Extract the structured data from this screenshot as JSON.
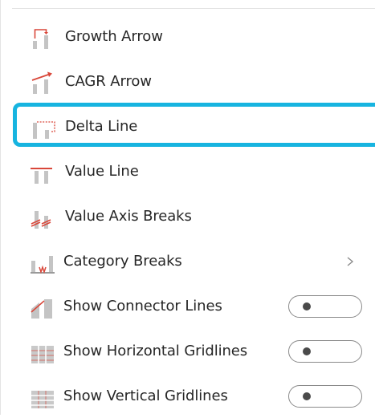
{
  "menu": {
    "items": [
      {
        "label": "Growth Arrow",
        "icon": "growth-arrow-icon"
      },
      {
        "label": "CAGR Arrow",
        "icon": "cagr-arrow-icon"
      },
      {
        "label": "Delta Line",
        "icon": "delta-line-icon",
        "focused": true
      },
      {
        "label": "Value Line",
        "icon": "value-line-icon"
      },
      {
        "label": "Value Axis Breaks",
        "icon": "value-axis-breaks-icon"
      },
      {
        "label": "Category Breaks",
        "icon": "category-breaks-icon",
        "submenu": true
      },
      {
        "label": "Show Connector Lines",
        "icon": "connector-lines-icon",
        "toggle": false
      },
      {
        "label": "Show Horizontal Gridlines",
        "icon": "horizontal-gridlines-icon",
        "toggle": false
      },
      {
        "label": "Show Vertical Gridlines",
        "icon": "vertical-gridlines-icon",
        "toggle": false
      }
    ]
  },
  "colors": {
    "focus_ring": "#17b4e0",
    "accent_red": "#d9473a",
    "icon_gray": "#bfbfbf"
  }
}
